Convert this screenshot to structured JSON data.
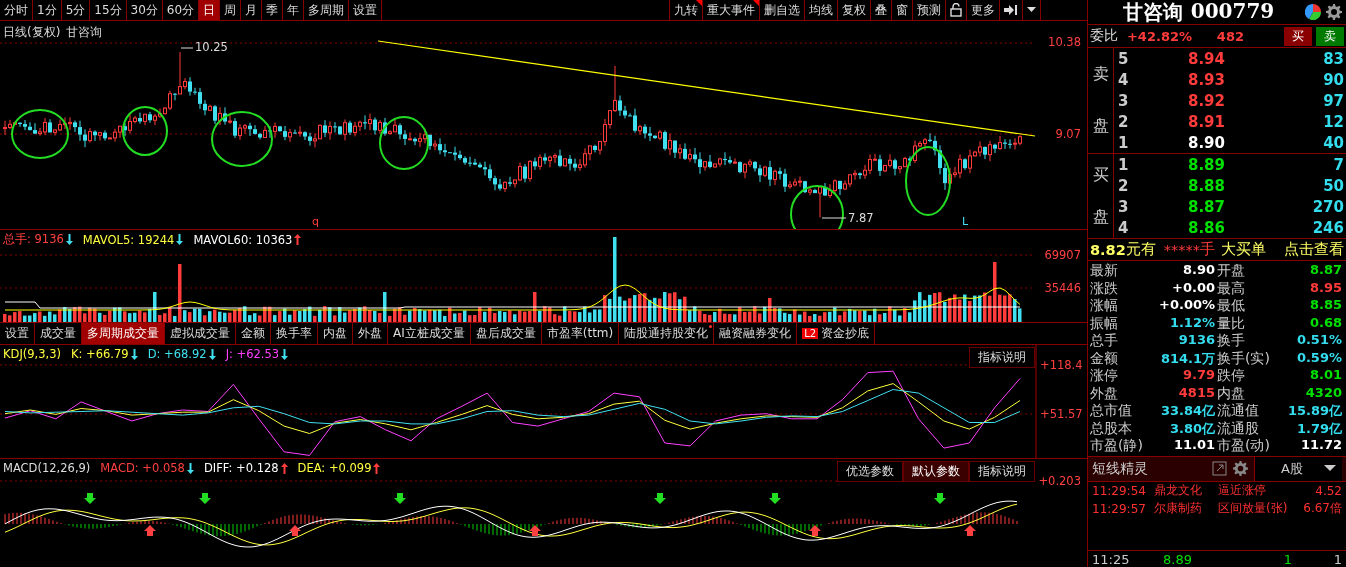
{
  "period_tabs": [
    {
      "label": "分时",
      "selected": false
    },
    {
      "label": "1分",
      "selected": false
    },
    {
      "label": "5分",
      "selected": false
    },
    {
      "label": "15分",
      "selected": false
    },
    {
      "label": "30分",
      "selected": false
    },
    {
      "label": "60分",
      "selected": false
    },
    {
      "label": "日",
      "selected": true
    },
    {
      "label": "周",
      "selected": false
    },
    {
      "label": "月",
      "selected": false
    },
    {
      "label": "季",
      "selected": false
    },
    {
      "label": "年",
      "selected": false
    },
    {
      "label": "多周期",
      "selected": false
    },
    {
      "label": "设置",
      "selected": false
    }
  ],
  "tools": [
    {
      "label": "九转",
      "flagged": true
    },
    {
      "label": "重大事件",
      "flagged": true
    },
    {
      "label": "删自选",
      "flagged": false
    },
    {
      "label": "均线",
      "flagged": false
    },
    {
      "label": "复权",
      "flagged": false
    },
    {
      "label": "叠",
      "flagged": false
    },
    {
      "label": "窗",
      "flagged": false
    },
    {
      "label": "预测",
      "flagged": false
    }
  ],
  "more_button": "更多",
  "price_chart": {
    "title": "日线(复权)",
    "stock": "甘咨询",
    "high_label": "10.25",
    "low_label": "7.87",
    "axis": [
      "10.38",
      "9.07"
    ],
    "markers": [
      "q",
      "L"
    ]
  },
  "volume": {
    "legend": [
      {
        "label": "总手: 9136",
        "color": "#ff4040",
        "rising": false
      },
      {
        "label": "MAVOL5: 19244",
        "color": "#ffff40",
        "rising": false
      },
      {
        "label": "MAVOL60: 10363",
        "color": "#ffffff",
        "rising": true
      }
    ],
    "axis": [
      "69907",
      "35446"
    ]
  },
  "indicator_tabs": [
    {
      "label": "设置",
      "selected": false
    },
    {
      "label": "成交量",
      "selected": false
    },
    {
      "label": "多周期成交量",
      "selected": true
    },
    {
      "label": "虚拟成交量",
      "selected": false
    },
    {
      "label": "金额",
      "selected": false
    },
    {
      "label": "换手率",
      "selected": false
    },
    {
      "label": "内盘",
      "selected": false
    },
    {
      "label": "外盘",
      "selected": false
    },
    {
      "label": "AI立桩成交量",
      "selected": false
    },
    {
      "label": "盘后成交量",
      "selected": false
    },
    {
      "label": "市盈率(ttm)",
      "selected": false
    },
    {
      "label": "陆股通持股变化",
      "selected": false,
      "dot": true
    },
    {
      "label": "融资融券变化",
      "selected": false
    },
    {
      "label": "资金抄底",
      "selected": false,
      "badge": "L2"
    }
  ],
  "kdj": {
    "name": "KDJ(9,3,3)",
    "legend": [
      {
        "label": "K: +66.79",
        "color": "#ffff40",
        "rising": false
      },
      {
        "label": "D: +68.92",
        "color": "#40e0f0",
        "rising": false
      },
      {
        "label": "J: +62.53",
        "color": "#ff40ff",
        "rising": false
      }
    ],
    "buttons": [
      {
        "label": "指标说明",
        "selected": false
      }
    ],
    "chart_data": {
      "type": "line",
      "ylim": [
        -8.5,
        145.7
      ],
      "yticks": [
        {
          "value": 118.4,
          "label": "+118.4"
        },
        {
          "value": 51.57,
          "label": "+51.57"
        }
      ],
      "series": [
        {
          "color": "#ff40ff",
          "values": [
            46,
            56,
            45,
            68,
            55,
            42,
            52,
            57,
            55,
            92,
            45,
            0,
            -5,
            41,
            48,
            30,
            15,
            45,
            62,
            80,
            40,
            35,
            45,
            55,
            80,
            75,
            12,
            8,
            42,
            50,
            52,
            45,
            45,
            71,
            108,
            110,
            45,
            5,
            12,
            60,
            100
          ]
        },
        {
          "color": "#ffff40",
          "values": [
            52,
            57,
            51,
            59,
            56,
            50,
            52,
            54,
            54,
            71,
            56,
            35,
            25,
            39,
            44,
            38,
            30,
            40,
            51,
            63,
            51,
            45,
            47,
            52,
            65,
            69,
            43,
            31,
            39,
            45,
            49,
            48,
            47,
            60,
            83,
            93,
            68,
            42,
            31,
            47,
            70
          ]
        },
        {
          "color": "#40e0f0",
          "values": [
            55,
            53,
            54,
            55,
            56,
            54,
            52,
            50,
            53,
            60,
            62,
            52,
            40,
            38,
            42,
            42,
            38,
            38,
            45,
            55,
            56,
            50,
            48,
            50,
            58,
            66,
            58,
            42,
            38,
            42,
            47,
            49,
            48,
            55,
            70,
            85,
            80,
            60,
            40,
            40,
            55
          ]
        }
      ]
    }
  },
  "macd": {
    "name": "MACD(12,26,9)",
    "legend": [
      {
        "label": "MACD: +0.058",
        "color": "#ff4040",
        "rising": false
      },
      {
        "label": "DIFF: +0.128",
        "color": "#ffffff",
        "rising": true
      },
      {
        "label": "DEA: +0.099",
        "color": "#ffff40",
        "rising": true
      }
    ],
    "axis": [
      "+0.203"
    ],
    "buttons": [
      {
        "label": "优选参数",
        "selected": false
      },
      {
        "label": "默认参数",
        "selected": true
      },
      {
        "label": "指标说明",
        "selected": false
      }
    ]
  },
  "quote": {
    "name": "甘咨询",
    "code": "000779",
    "ratio_label": "委比",
    "ratio": "+42.82%",
    "ratio_diff": "482",
    "buy": "买",
    "sell": "卖"
  },
  "asks": {
    "label_top": "卖",
    "label_bottom": "盘",
    "rows": [
      {
        "level": "5",
        "price": "8.94",
        "volume": "83",
        "color": "#ff3b3b"
      },
      {
        "level": "4",
        "price": "8.93",
        "volume": "90",
        "color": "#ff3b3b"
      },
      {
        "level": "3",
        "price": "8.92",
        "volume": "97",
        "color": "#ff3b3b"
      },
      {
        "level": "2",
        "price": "8.91",
        "volume": "12",
        "color": "#ff3b3b"
      },
      {
        "level": "1",
        "price": "8.90",
        "volume": "40",
        "color": "#ffffff"
      }
    ]
  },
  "bids": {
    "label_top": "买",
    "label_bottom": "盘",
    "rows": [
      {
        "level": "1",
        "price": "8.89",
        "volume": "7",
        "color": "#00e000"
      },
      {
        "level": "2",
        "price": "8.88",
        "volume": "50",
        "color": "#00e000"
      },
      {
        "level": "3",
        "price": "8.87",
        "volume": "270",
        "color": "#00e000"
      },
      {
        "level": "4",
        "price": "8.86",
        "volume": "246",
        "color": "#00e000"
      }
    ]
  },
  "big_order": {
    "price": "8.82",
    "text": "元有",
    "masked": "*****",
    "unit": "手",
    "label": "大买单",
    "link": "点击查看"
  },
  "stats": [
    {
      "left": {
        "label": "最新",
        "value": "8.90",
        "color": "#ffffff"
      },
      "right": {
        "label": "开盘",
        "value": "8.87",
        "color": "#00e000"
      }
    },
    {
      "left": {
        "label": "涨跌",
        "value": "+0.00",
        "color": "#ffffff"
      },
      "right": {
        "label": "最高",
        "value": "8.95",
        "color": "#ff3b3b"
      }
    },
    {
      "left": {
        "label": "涨幅",
        "value": "+0.00%",
        "color": "#ffffff"
      },
      "right": {
        "label": "最低",
        "value": "8.85",
        "color": "#00e000"
      }
    },
    {
      "left": {
        "label": "振幅",
        "value": "1.12%",
        "color": "#33ddee"
      },
      "right": {
        "label": "量比",
        "value": "0.68",
        "color": "#00e000"
      }
    },
    {
      "left": {
        "label": "总手",
        "value": "9136",
        "color": "#33ddee"
      },
      "right": {
        "label": "换手",
        "value": "0.51%",
        "color": "#33ddee"
      }
    },
    {
      "left": {
        "label": "金额",
        "value": "814.1万",
        "color": "#33ddee"
      },
      "right": {
        "label": "换手(实)",
        "value": "0.59%",
        "color": "#33ddee"
      }
    },
    {
      "left": {
        "label": "涨停",
        "value": "9.79",
        "color": "#ff3b3b"
      },
      "right": {
        "label": "跌停",
        "value": "8.01",
        "color": "#00e000"
      }
    },
    {
      "left": {
        "label": "外盘",
        "value": "4815",
        "color": "#ff3b3b"
      },
      "right": {
        "label": "内盘",
        "value": "4320",
        "color": "#00e000"
      }
    },
    {
      "left": {
        "label": "总市值",
        "value": "33.84亿",
        "color": "#33ddee"
      },
      "right": {
        "label": "流通值",
        "value": "15.89亿",
        "color": "#33ddee"
      }
    },
    {
      "left": {
        "label": "总股本",
        "value": "3.80亿",
        "color": "#33ddee"
      },
      "right": {
        "label": "流通股",
        "value": "1.79亿",
        "color": "#33ddee"
      }
    },
    {
      "left": {
        "label": "市盈(静)",
        "value": "11.01",
        "color": "#ffffff"
      },
      "right": {
        "label": "市盈(动)",
        "value": "11.72",
        "color": "#ffffff"
      }
    }
  ],
  "sprite": {
    "title": "短线精灵",
    "market": "A股",
    "rows": [
      {
        "time": "11:29:54",
        "name": "鼎龙文化",
        "event": "逼近涨停",
        "value": "4.52"
      },
      {
        "time": "11:29:57",
        "name": "尔康制药",
        "event": "区间放量(张)",
        "value": "6.67倍"
      }
    ]
  },
  "ticks": [
    {
      "time": "11:25",
      "price": "8.89",
      "volume": "1",
      "count": "1"
    }
  ]
}
